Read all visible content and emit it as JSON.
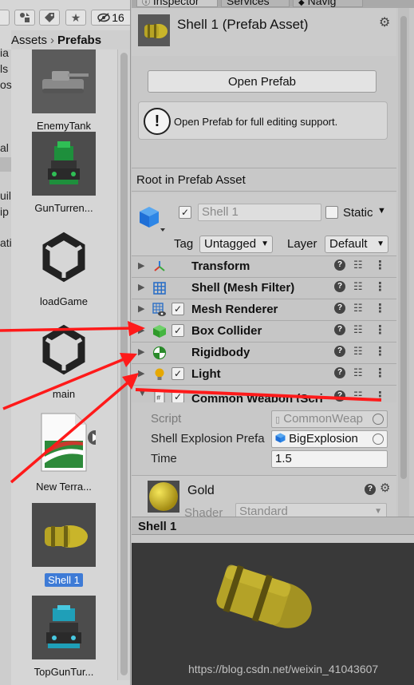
{
  "toolbar": {
    "search_count": "16"
  },
  "breadcrumb": {
    "root": "Assets",
    "current": "Prefabs"
  },
  "folder_strip": {
    "items": [
      "ia",
      "ls",
      "os",
      "al",
      "uil",
      "ip",
      "ati"
    ]
  },
  "assets": [
    {
      "name": "EnemyTank",
      "icon": "tank-thumbnail",
      "selected": false
    },
    {
      "name": "GunTurren...",
      "icon": "turret-thumbnail",
      "selected": false
    },
    {
      "name": "loadGame",
      "icon": "unity-logo",
      "selected": false
    },
    {
      "name": "main",
      "icon": "unity-logo",
      "selected": false
    },
    {
      "name": "New Terra...",
      "icon": "terrain-data-icon",
      "selected": false
    },
    {
      "name": "Shell 1",
      "icon": "shell-thumbnail",
      "selected": true
    },
    {
      "name": "TopGunTur...",
      "icon": "turret-thumbnail",
      "selected": false
    }
  ],
  "inspector": {
    "tabs": [
      "Inspector",
      "Services",
      "Navig"
    ],
    "header_title": "Shell 1 (Prefab Asset)",
    "open_prefab_label": "Open Prefab",
    "help_text": "Open Prefab for full editing support.",
    "root_label": "Root in Prefab Asset",
    "gameobject": {
      "name": "Shell 1",
      "active": true,
      "static_label": "Static",
      "tag_label": "Tag",
      "tag_value": "Untagged",
      "layer_label": "Layer",
      "layer_value": "Default"
    },
    "components": [
      {
        "name": "Transform",
        "icon": "transform-icon",
        "has_checkbox": false
      },
      {
        "name": "Shell (Mesh Filter)",
        "icon": "mesh-filter-icon",
        "has_checkbox": false
      },
      {
        "name": "Mesh Renderer",
        "icon": "mesh-renderer-icon",
        "has_checkbox": true
      },
      {
        "name": "Box Collider",
        "icon": "box-collider-icon",
        "has_checkbox": true
      },
      {
        "name": "Rigidbody",
        "icon": "rigidbody-icon",
        "has_checkbox": false
      },
      {
        "name": "Light",
        "icon": "light-icon",
        "has_checkbox": true
      },
      {
        "name": "Common Weapon (Scri",
        "icon": "script-icon",
        "has_checkbox": true
      }
    ],
    "script_fields": {
      "script_label": "Script",
      "script_value": "CommonWeap",
      "explosion_label": "Shell Explosion Prefa",
      "explosion_value": "BigExplosion",
      "time_label": "Time",
      "time_value": "1.5"
    },
    "material": {
      "name": "Gold",
      "shader_label": "Shader",
      "shader_value": "Standard"
    },
    "preview_title": "Shell 1",
    "watermark": "https://blog.csdn.net/weixin_41043607"
  },
  "colors": {
    "selection": "#3e7bd6",
    "annotation_red": "#ff1a1a",
    "preview_bg": "#393939",
    "gold": "#c9b52a"
  }
}
